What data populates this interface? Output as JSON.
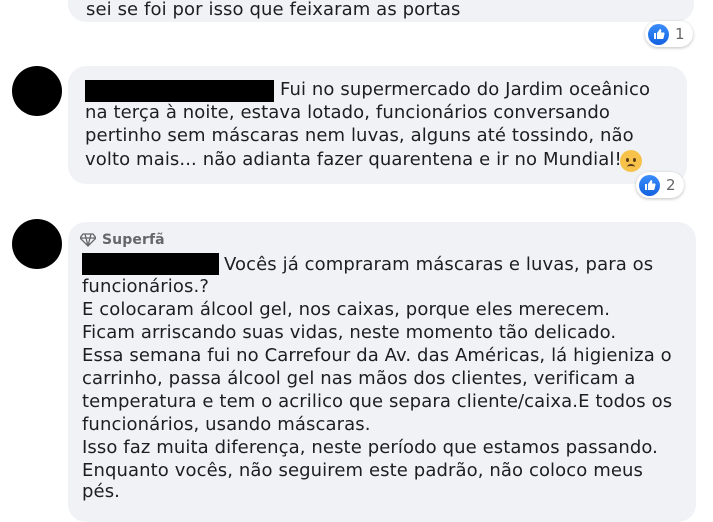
{
  "comments": [
    {
      "lines": [
        "sei se foi por isso que feixaram as portas"
      ],
      "reaction_count": "1"
    },
    {
      "lines": [
        "Fui no supermercado do Jardim oceânico",
        "na terça à noite, estava lotado, funcionários conversando",
        "pertinho sem máscaras nem luvas, alguns até tossindo, não",
        "volto mais... não adianta fazer quarentena e ir no Mundial!"
      ],
      "reaction_count": "2"
    },
    {
      "badge": "Superfã",
      "lines": [
        "Vocês já compraram máscaras e luvas, para os",
        "funcionários.?",
        "E colocaram álcool gel, nos caixas, porque eles merecem.",
        "Ficam arriscando suas vidas, neste momento tão delicado.",
        "Essa semana fui no Carrefour da Av. das Américas, lá higieniza o",
        "carrinho, passa álcool gel nas mãos dos clientes, verificam a",
        "temperatura e tem o acrilico que separa cliente/caixa.E todos os",
        "funcionários, usando máscaras.",
        "Isso faz muita diferença, neste período que estamos passando.",
        "Enquanto vocês, não seguirem este padrão, não coloco meus",
        "pés."
      ]
    }
  ],
  "icons": {
    "like": "thumbs-up-icon",
    "badge": "diamond-icon",
    "emoji": "frowning-face-emoji"
  },
  "colors": {
    "bubble": "#f0f2f5",
    "like": "#1877f2",
    "text": "#1c1e21"
  }
}
